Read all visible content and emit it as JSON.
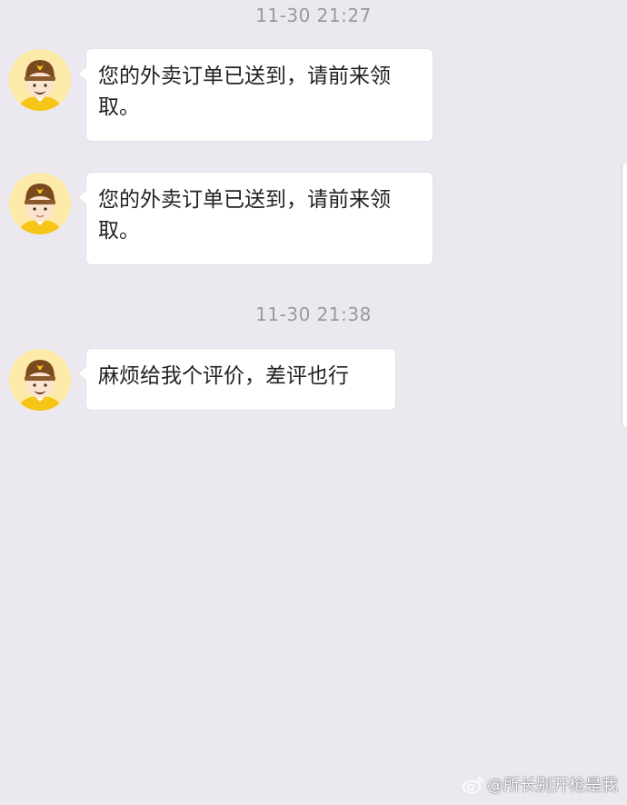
{
  "conversation": {
    "groups": [
      {
        "timestamp": "11-30 21:27",
        "messages": [
          {
            "sender": "courier",
            "text": "您的外卖订单已送到，请前来领取。"
          },
          {
            "sender": "courier",
            "text": "您的外卖订单已送到，请前来领取。"
          }
        ]
      },
      {
        "timestamp": "11-30 21:38",
        "messages": [
          {
            "sender": "courier",
            "text": "麻烦给我个评价，差评也行"
          }
        ]
      }
    ]
  },
  "watermark": {
    "icon": "weibo-logo-icon",
    "text": "@所长别开枪是我"
  },
  "colors": {
    "background": "#ebe9ef",
    "bubble": "#ffffff",
    "timestamp_text": "#9a98a0",
    "avatar_bg": "#fde9a8",
    "helmet": "#7a4a1f",
    "uniform": "#f5c518"
  }
}
